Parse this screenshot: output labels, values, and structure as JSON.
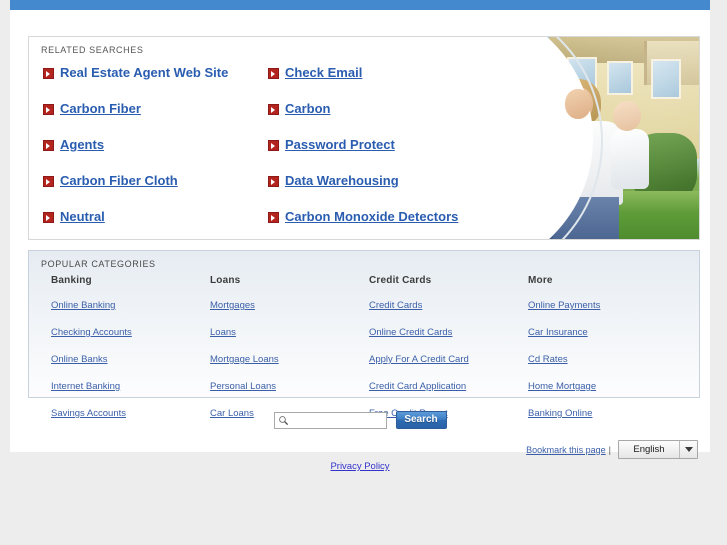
{
  "theme": {
    "topbar_color": "#4489ce",
    "link_color": "#2a5db0",
    "bullet_color": "#b3241f",
    "page_bg": "#ededed"
  },
  "related": {
    "heading": "RELATED SEARCHES",
    "left_column": [
      {
        "label": "Real Estate Agent Web Site",
        "underlined": false
      },
      {
        "label": "Carbon Fiber",
        "underlined": true
      },
      {
        "label": "Agents",
        "underlined": true
      },
      {
        "label": "Carbon Fiber Cloth",
        "underlined": true
      },
      {
        "label": "Neutral",
        "underlined": true
      }
    ],
    "right_column": [
      {
        "label": "Check Email",
        "underlined": true
      },
      {
        "label": "Carbon",
        "underlined": true
      },
      {
        "label": "Password Protect",
        "underlined": true
      },
      {
        "label": "Data Warehousing",
        "underlined": true
      },
      {
        "label": "Carbon Monoxide Detectors",
        "underlined": true
      }
    ],
    "photo_alt": "family-with-baby-in-front-of-house"
  },
  "categories": {
    "heading": "POPULAR CATEGORIES",
    "columns": [
      {
        "title": "Banking",
        "items": [
          "Online Banking",
          "Checking Accounts",
          "Online Banks",
          "Internet Banking",
          "Savings Accounts"
        ]
      },
      {
        "title": "Loans",
        "items": [
          "Mortgages",
          "Loans",
          "Mortgage Loans",
          "Personal Loans",
          "Car Loans"
        ]
      },
      {
        "title": "Credit Cards",
        "items": [
          "Credit Cards",
          "Online Credit Cards",
          "Apply For A Credit Card",
          "Credit Card Application",
          "Free Credit Report"
        ]
      },
      {
        "title": "More",
        "items": [
          "Online Payments",
          "Car Insurance",
          "Cd Rates",
          "Home Mortgage",
          "Banking Online"
        ]
      }
    ]
  },
  "search": {
    "value": "",
    "placeholder": "",
    "button_label": "Search"
  },
  "footer": {
    "bookmark_label": "Bookmark this page",
    "separator": "|",
    "language_value": "English",
    "privacy_label": "Privacy Policy"
  }
}
